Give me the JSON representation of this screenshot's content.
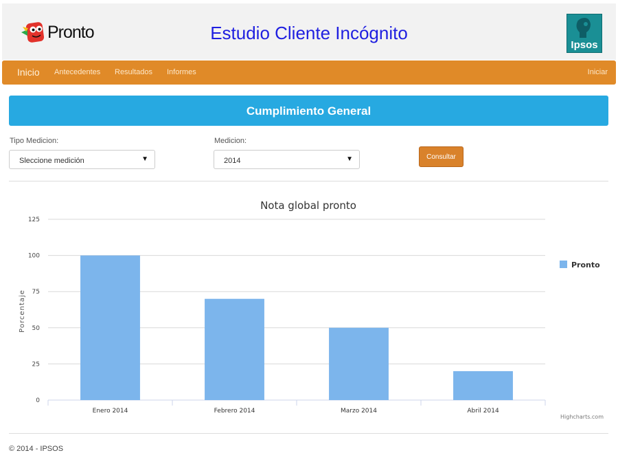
{
  "header": {
    "logo_text": "Pronto",
    "title": "Estudio Cliente Incógnito",
    "partner_logo_text": "Ipsos"
  },
  "nav": {
    "items": [
      {
        "label": "Inicio",
        "active": true
      },
      {
        "label": "Antecedentes"
      },
      {
        "label": "Resultados"
      },
      {
        "label": "Informes"
      }
    ],
    "right_label": "Iniciar"
  },
  "banner": {
    "title": "Cumplimiento General"
  },
  "form": {
    "tipo_label": "Tipo Medicion:",
    "tipo_value": "Sleccione medición",
    "medicion_label": "Medicion:",
    "medicion_value": "2014",
    "submit_label": "Consultar"
  },
  "chart_data": {
    "type": "bar",
    "title": "Nota global pronto",
    "ylabel": "Porcentaje",
    "xlabel": "",
    "categories": [
      "Enero 2014",
      "Febrero 2014",
      "Marzo 2014",
      "Abril 2014"
    ],
    "series": [
      {
        "name": "Pronto",
        "values": [
          100,
          70,
          50,
          20
        ],
        "color": "#7cb5ec"
      }
    ],
    "ylim": [
      0,
      125
    ],
    "yticks": [
      "0",
      "25",
      "50",
      "75",
      "100",
      "125"
    ],
    "grid": true,
    "legend": "right",
    "credits": "Highcharts.com"
  },
  "footer": {
    "text": "© 2014 - IPSOS"
  },
  "colors": {
    "nav": "#e08a28",
    "banner": "#27a9e1",
    "bar": "#7cb5ec",
    "button": "#d9822b"
  }
}
